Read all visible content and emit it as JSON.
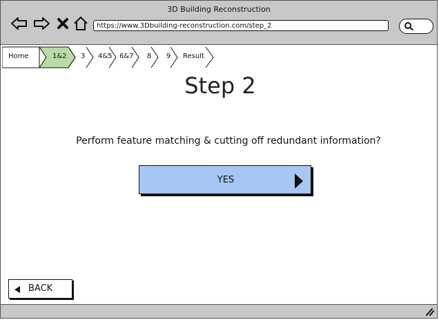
{
  "window": {
    "title": "3D Building Reconstruction"
  },
  "toolbar": {
    "icons": [
      "back-arrow-icon",
      "forward-arrow-icon",
      "close-x-icon",
      "home-icon"
    ],
    "url": "https://www.3Dbuilding-reconstruction.com/step_2",
    "search_icon": "search-icon"
  },
  "breadcrumb": {
    "items": [
      {
        "label": "Home",
        "active": false
      },
      {
        "label": "1&2",
        "active": true
      },
      {
        "label": "3",
        "active": false
      },
      {
        "label": "4&5",
        "active": false
      },
      {
        "label": "6&7",
        "active": false
      },
      {
        "label": "8",
        "active": false
      },
      {
        "label": "9",
        "active": false
      },
      {
        "label": "Result",
        "active": false
      }
    ],
    "active_color": "#b9dba6"
  },
  "main": {
    "title": "Step 2",
    "question": "Perform feature matching & cutting off redundant information?",
    "yes_label": "YES",
    "yes_color": "#a7c6f4",
    "back_label": "BACK"
  },
  "statusbar": {
    "resize_icon": "resize-grip-icon"
  }
}
